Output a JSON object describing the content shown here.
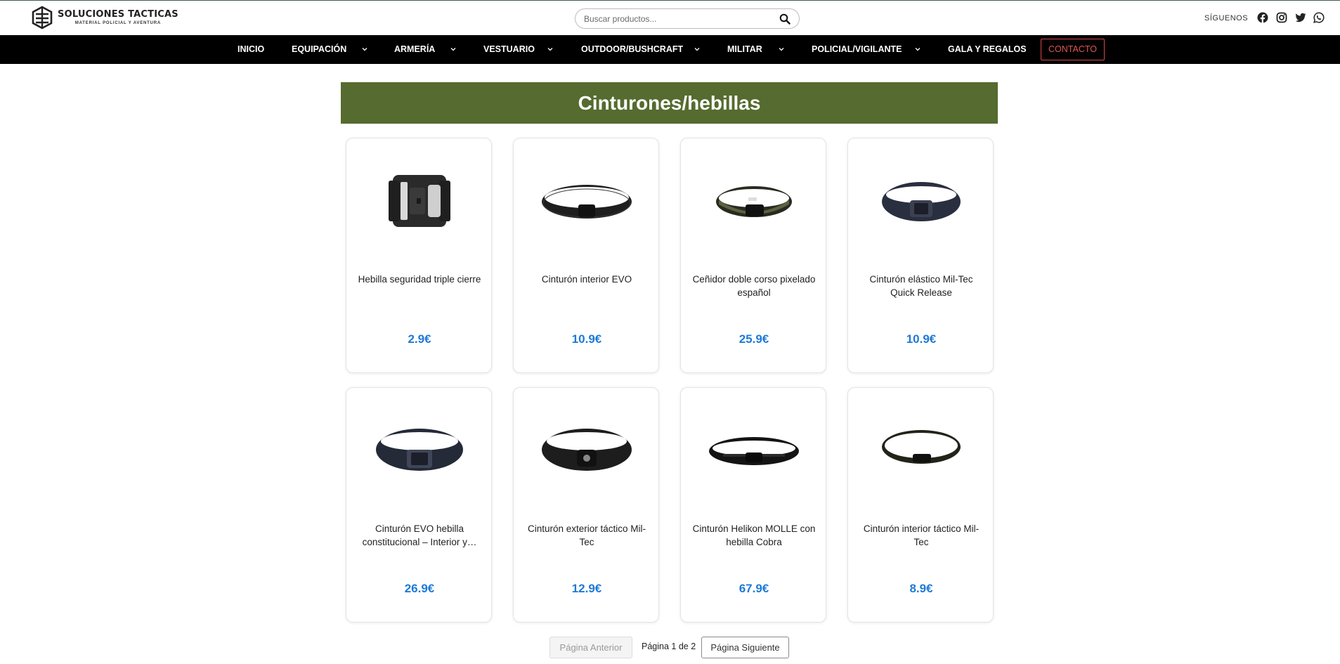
{
  "header": {
    "logo_title": "SOLUCIONES TACTICAS",
    "logo_subtitle": "MATERIAL POLICIAL Y AVENTURA",
    "search_placeholder": "Buscar productos...",
    "follow_label": "SÍGUENOS",
    "social_icons": [
      "facebook-icon",
      "instagram-icon",
      "twitter-icon",
      "whatsapp-icon"
    ]
  },
  "nav": {
    "items": [
      {
        "label": "INICIO"
      },
      {
        "label": "EQUIPACIÓN"
      },
      {
        "label": "ARMERÍA"
      },
      {
        "label": "VESTUARIO"
      },
      {
        "label": "OUTDOOR/BUSHCRAFT"
      },
      {
        "label": "MILITAR"
      },
      {
        "label": "POLICIAL/VIGILANTE"
      },
      {
        "label": "GALA Y REGALOS"
      }
    ],
    "contact_label": "CONTACTO"
  },
  "category": {
    "title": "Cinturones/hebillas"
  },
  "products": [
    {
      "name": "Hebilla seguridad triple cierre",
      "price": "2.9€"
    },
    {
      "name": "Cinturón interior EVO",
      "price": "10.9€"
    },
    {
      "name": "Ceñidor doble corso pixelado español",
      "price": "25.9€"
    },
    {
      "name": "Cinturón elástico Mil-Tec Quick Release",
      "price": "10.9€"
    },
    {
      "name": "Cinturón EVO hebilla constitucional – Interior y…",
      "price": "26.9€"
    },
    {
      "name": "Cinturón exterior táctico Mil-Tec",
      "price": "12.9€"
    },
    {
      "name": "Cinturón Helikon MOLLE con hebilla Cobra",
      "price": "67.9€"
    },
    {
      "name": "Cinturón interior táctico Mil-Tec",
      "price": "8.9€"
    }
  ],
  "pagination": {
    "prev_label": "Página Anterior",
    "info": "Página 1 de 2",
    "next_label": "Página Siguiente"
  },
  "colors": {
    "nav_bg": "#000000",
    "banner_bg": "#556b2f",
    "price": "#1d7ad6",
    "contact_border": "#d94646"
  }
}
